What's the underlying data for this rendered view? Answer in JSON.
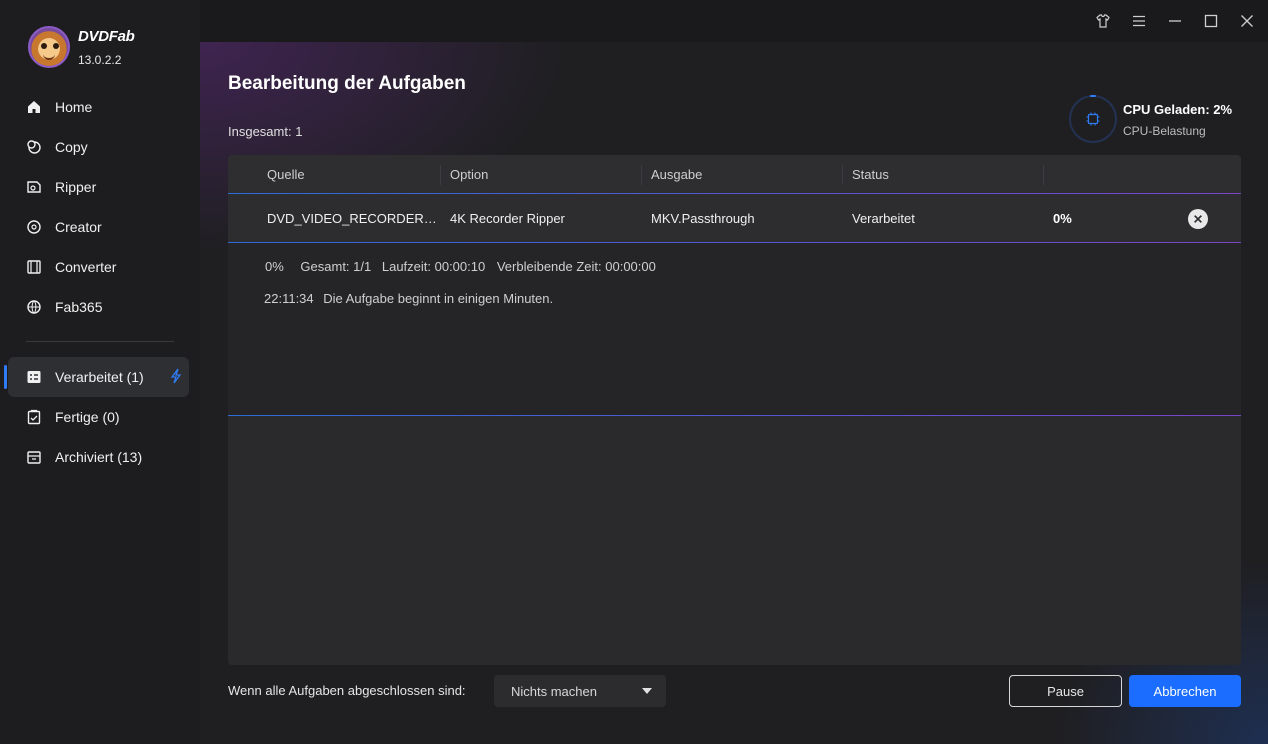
{
  "app": {
    "name": "DVDFab",
    "version": "13.0.2.2"
  },
  "sidebar": {
    "items": [
      {
        "label": "Home",
        "icon": "home-icon"
      },
      {
        "label": "Copy",
        "icon": "copy-icon"
      },
      {
        "label": "Ripper",
        "icon": "ripper-icon"
      },
      {
        "label": "Creator",
        "icon": "creator-icon"
      },
      {
        "label": "Converter",
        "icon": "converter-icon"
      },
      {
        "label": "Fab365",
        "icon": "fab365-icon"
      }
    ],
    "tasks": [
      {
        "label": "Verarbeitet (1)",
        "icon": "processing-icon",
        "active": true
      },
      {
        "label": "Fertige (0)",
        "icon": "finished-icon",
        "active": false
      },
      {
        "label": "Archiviert (13)",
        "icon": "archive-icon",
        "active": false
      }
    ]
  },
  "titlebar": {
    "icons": [
      "skin-icon",
      "menu-icon",
      "minimize-icon",
      "maximize-icon",
      "close-icon"
    ]
  },
  "main": {
    "title": "Bearbeitung der Aufgaben",
    "total": "Insgesamt: 1",
    "cpu_label": "CPU Geladen: 2%",
    "cpu_sub": "CPU-Belastung"
  },
  "table": {
    "headers": [
      "Quelle",
      "Option",
      "Ausgabe",
      "Status"
    ],
    "row": {
      "source": "DVD_VIDEO_RECORDER_VR",
      "option": "4K Recorder Ripper",
      "output": "MKV.Passthrough",
      "status": "Verarbeitet",
      "percent": "0%"
    },
    "details": {
      "percent": "0%",
      "total": "Gesamt: 1/1",
      "runtime": "Laufzeit: 00:00:10",
      "remaining": "Verbleibende Zeit: 00:00:00",
      "log_time": "22:11:34",
      "log_text": "Die Aufgabe beginnt in einigen Minuten."
    }
  },
  "footer": {
    "label": "Wenn alle Aufgaben abgeschlossen sind:",
    "select_value": "Nichts machen",
    "pause_label": "Pause",
    "cancel_label": "Abbrechen"
  },
  "colors": {
    "accent": "#1a6dff",
    "sidebar_bg": "#1d1d1f",
    "table_bg": "#2a2a2d"
  }
}
